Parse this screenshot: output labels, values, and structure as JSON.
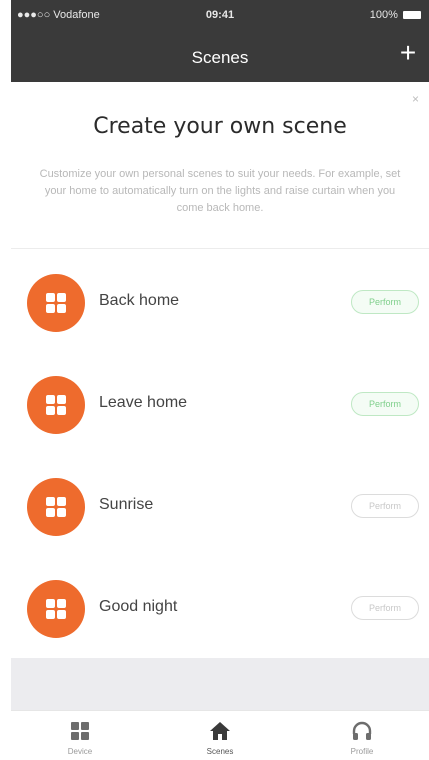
{
  "status_bar": {
    "carrier": "●●●○○ Vodafone",
    "time": "09:41",
    "battery": "100%"
  },
  "nav": {
    "title": "Scenes",
    "add_label": "+"
  },
  "promo": {
    "close_label": "×",
    "title": "Create your own scene",
    "text": "Customize your own personal scenes to suit your needs. For example, set your home to automatically turn on the lights and raise curtain when you come back home."
  },
  "scenes": [
    {
      "name": "Back home",
      "status": "Perform",
      "active": true
    },
    {
      "name": "Leave home",
      "status": "Perform",
      "active": true
    },
    {
      "name": "Sunrise",
      "status": "Perform",
      "active": false
    },
    {
      "name": "Good night",
      "status": "Perform",
      "active": false
    }
  ],
  "tabs": [
    {
      "label": "Device",
      "icon": "grid-icon"
    },
    {
      "label": "Scenes",
      "icon": "home-icon"
    },
    {
      "label": "Profile",
      "icon": "headphones-icon"
    }
  ],
  "colors": {
    "accent": "#ee6b2d",
    "header": "#3a3a3a",
    "active_status": "#7fcf8b"
  }
}
